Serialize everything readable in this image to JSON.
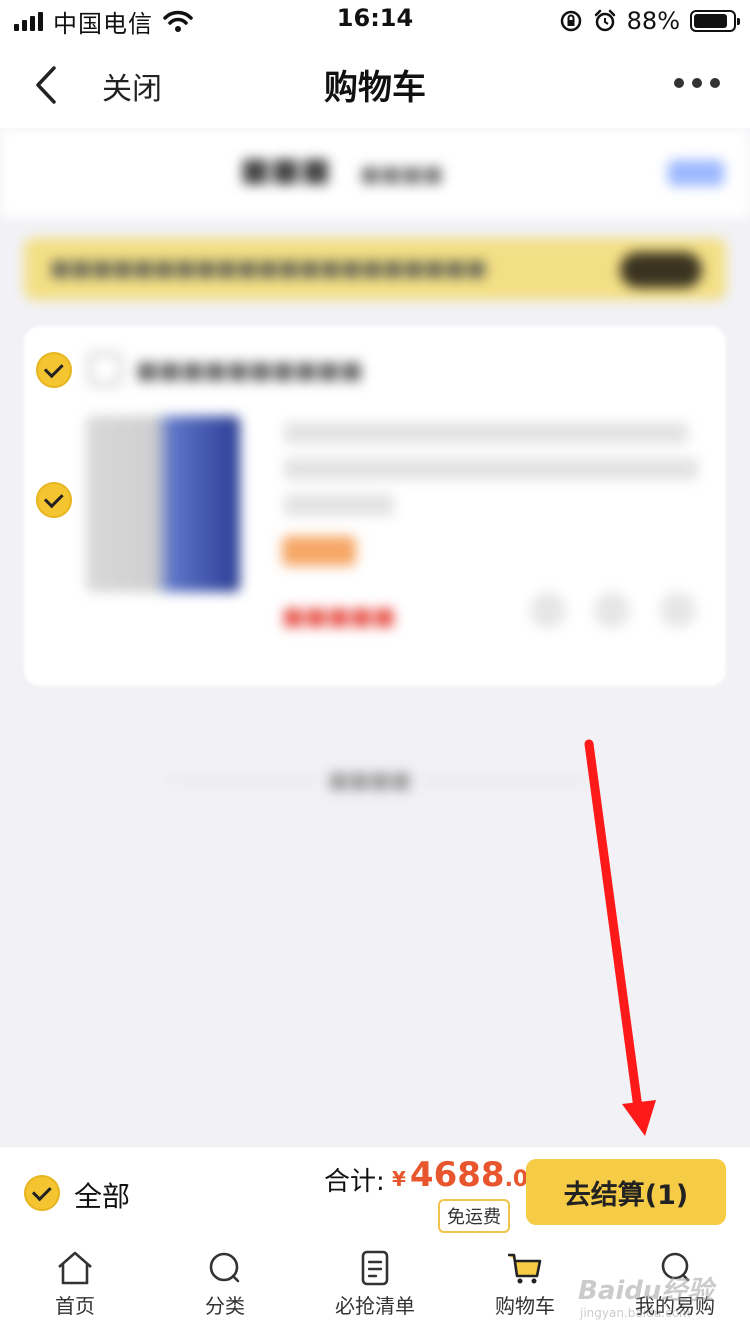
{
  "status_bar": {
    "carrier": "中国电信",
    "time": "16:14",
    "battery_percent": "88%",
    "battery_level": 0.88
  },
  "nav": {
    "close_label": "关闭",
    "title": "购物车"
  },
  "checkout": {
    "select_all_label": "全部",
    "total_label": "合计:",
    "currency_symbol": "¥",
    "total_integer": "4688",
    "total_decimal": ".00",
    "shipping_badge": "免运费",
    "checkout_button": "去结算(1)",
    "price_color": "#e8562e",
    "accent_color": "#f6cc47"
  },
  "tabs": [
    {
      "label": "首页",
      "icon": "home-icon"
    },
    {
      "label": "分类",
      "icon": "search-icon"
    },
    {
      "label": "必抢清单",
      "icon": "list-icon"
    },
    {
      "label": "购物车",
      "icon": "cart-icon"
    },
    {
      "label": "我的易购",
      "icon": "user-icon"
    }
  ],
  "watermark": {
    "text": "Baidu经验",
    "sub": "jingyan.baidu.com"
  },
  "annotation": {
    "arrow_color": "#ff1a1a"
  }
}
